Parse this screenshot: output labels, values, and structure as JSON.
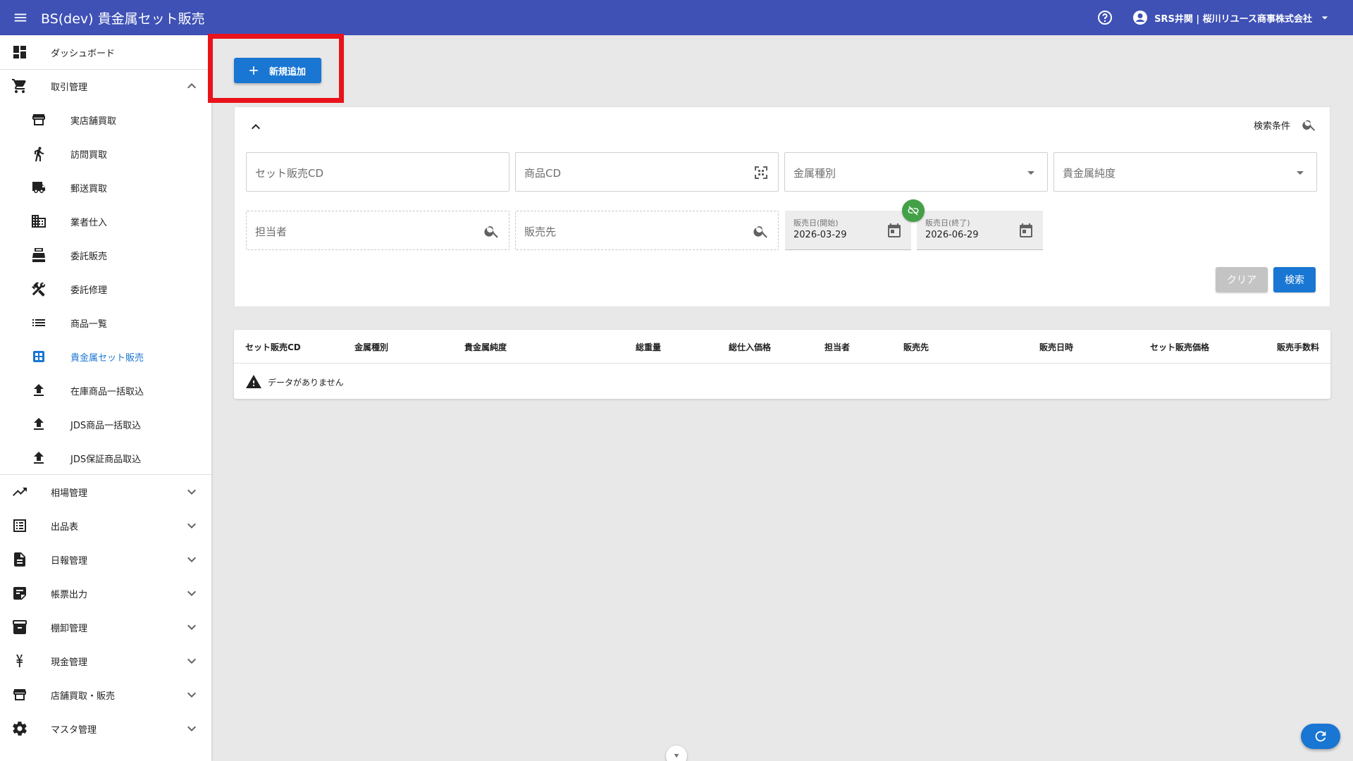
{
  "header": {
    "title": "BS(dev) 貴金属セット販売",
    "user": "SRS井関 | 桜川リユース商事株式会社",
    "bg_color": "#3f51b5"
  },
  "sidebar": {
    "items": [
      {
        "label": "ダッシュボード",
        "icon": "dashboard-icon"
      },
      {
        "label": "取引管理",
        "icon": "cart-icon",
        "expanded": true
      },
      {
        "label": "実店舗買取",
        "icon": "store-icon"
      },
      {
        "label": "訪問買取",
        "icon": "walk-icon"
      },
      {
        "label": "郵送買取",
        "icon": "truck-icon"
      },
      {
        "label": "業者仕入",
        "icon": "building-icon"
      },
      {
        "label": "委託販売",
        "icon": "register-icon"
      },
      {
        "label": "委託修理",
        "icon": "tools-icon"
      },
      {
        "label": "商品一覧",
        "icon": "list-icon"
      },
      {
        "label": "貴金属セット販売",
        "icon": "grid-icon",
        "active": true
      },
      {
        "label": "在庫商品一括取込",
        "icon": "upload-icon"
      },
      {
        "label": "JDS商品一括取込",
        "icon": "upload-icon"
      },
      {
        "label": "JDS保証商品取込",
        "icon": "upload-icon"
      },
      {
        "label": "相場管理",
        "icon": "trend-icon"
      },
      {
        "label": "出品表",
        "icon": "listbox-icon"
      },
      {
        "label": "日報管理",
        "icon": "document-icon"
      },
      {
        "label": "帳票出力",
        "icon": "note-icon"
      },
      {
        "label": "棚卸管理",
        "icon": "archive-icon"
      },
      {
        "label": "現金管理",
        "icon": "yen-icon"
      },
      {
        "label": "店舗買取・販売",
        "icon": "store-icon"
      },
      {
        "label": "マスタ管理",
        "icon": "gear-icon"
      }
    ],
    "active_color": "#1976d2"
  },
  "toolbar": {
    "add_label": "新規追加"
  },
  "search": {
    "criteria_label": "検索条件",
    "set_cd_placeholder": "セット販売CD",
    "product_cd_placeholder": "商品CD",
    "metal_type_placeholder": "金属種別",
    "purity_placeholder": "貴金属純度",
    "staff_placeholder": "担当者",
    "customer_placeholder": "販売先",
    "date_start_label": "販売日(開始)",
    "date_start_value": "2026-03-29",
    "date_end_label": "販売日(終了)",
    "date_end_value": "2026-06-29",
    "clear_label": "クリア",
    "search_label": "検索"
  },
  "table": {
    "columns": [
      "セット販売CD",
      "金属種別",
      "貴金属純度",
      "総重量",
      "総仕入価格",
      "担当者",
      "販売先",
      "販売日時",
      "セット販売価格",
      "販売手数料"
    ],
    "empty_message": "データがありません"
  }
}
